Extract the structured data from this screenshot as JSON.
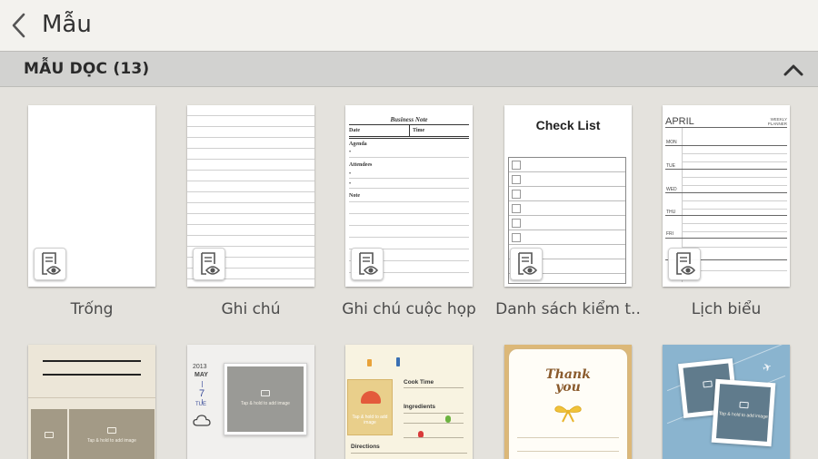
{
  "header": {
    "title": "Mẫu",
    "back_icon": "chevron-left-icon"
  },
  "section": {
    "title": "MẪU DỌC (13)",
    "toggle_icon": "chevron-up-icon"
  },
  "templates": [
    {
      "label": "Trống"
    },
    {
      "label": "Ghi chú"
    },
    {
      "label": "Ghi chú cuộc họp"
    },
    {
      "label": "Danh sách kiểm t.."
    },
    {
      "label": "Lịch biểu"
    }
  ],
  "business_note": {
    "title": "Business Note",
    "date": "Date",
    "time": "Time",
    "agenda": "Agenda",
    "bullet": "•",
    "attendees": "Attendees",
    "note": "Note"
  },
  "check_list": {
    "title": "Check List"
  },
  "planner": {
    "month": "APRIL",
    "tag_line1": "WEEKLY",
    "tag_line2": "PLANNER",
    "days": [
      "MON",
      "TUE",
      "WED",
      "THU",
      "FRI"
    ]
  },
  "photo_hint": "Tap & hold to add image",
  "diary": {
    "year": "2013",
    "month": "MAY",
    "day": "7",
    "weekday": "TUE"
  },
  "recipe": {
    "cook_time": "Cook Time",
    "ingredients": "Ingredients",
    "directions": "Directions"
  },
  "thanks": {
    "line1": "Thank",
    "line2": "you"
  },
  "colors": {
    "accent": "#9e9684",
    "background": "#e4e2dd",
    "section": "#d2d2d0"
  }
}
